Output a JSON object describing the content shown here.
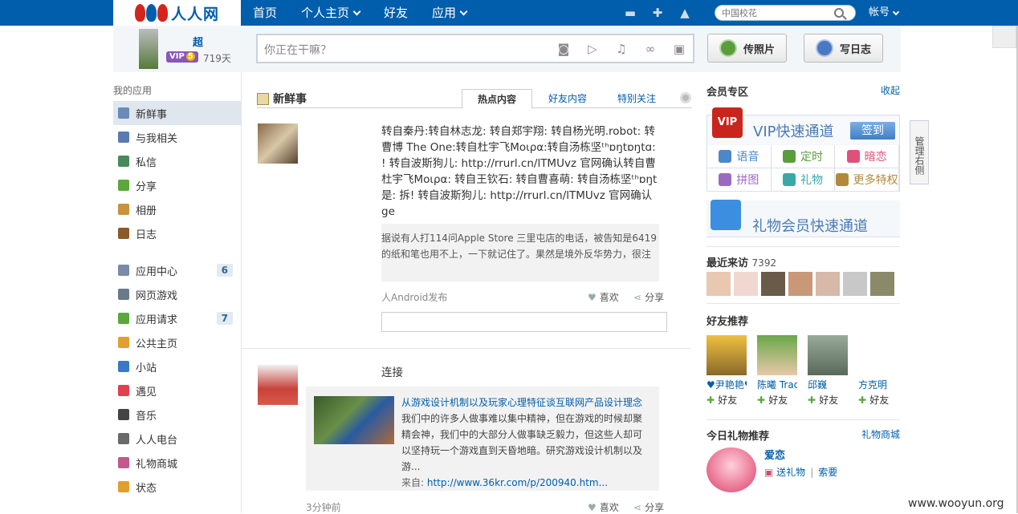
{
  "topbar": {
    "logo": "人人网",
    "nav": [
      "首页",
      "个人主页",
      "好友",
      "应用"
    ],
    "search_placeholder": "中国校花",
    "account": "帐号",
    "icons": [
      "chat-icon",
      "add-friend-icon",
      "bell-icon"
    ]
  },
  "publisher": {
    "name": "超",
    "vip": "VIP",
    "vip_level": "5",
    "days": "719天",
    "placeholder": "你正在干嘛？",
    "photo_btn": "传照片",
    "blog_btn": "写日志"
  },
  "sidebar": {
    "title": "我的应用",
    "items": [
      {
        "label": "新鲜事",
        "icon": "news-icon",
        "active": true
      },
      {
        "label": "与我相关",
        "icon": "mention-icon"
      },
      {
        "label": "私信",
        "icon": "message-icon"
      },
      {
        "label": "分享",
        "icon": "share-icon"
      },
      {
        "label": "相册",
        "icon": "album-icon"
      },
      {
        "label": "日志",
        "icon": "blog-icon"
      }
    ],
    "items2": [
      {
        "label": "应用中心",
        "icon": "app-center-icon",
        "badge": "6"
      },
      {
        "label": "网页游戏",
        "icon": "gamepad-icon"
      },
      {
        "label": "应用请求",
        "icon": "puzzle-icon",
        "badge": "7"
      },
      {
        "label": "公共主页",
        "icon": "bookmark-icon"
      },
      {
        "label": "小站",
        "icon": "station-icon"
      },
      {
        "label": "遇见",
        "icon": "heart-icon"
      },
      {
        "label": "音乐",
        "icon": "music-icon"
      },
      {
        "label": "人人电台",
        "icon": "radio-icon"
      },
      {
        "label": "礼物商城",
        "icon": "gift-icon"
      },
      {
        "label": "状态",
        "icon": "status-icon"
      }
    ]
  },
  "feed": {
    "title": "新鲜事",
    "tabs": [
      "热点内容",
      "好友内容",
      "特别关注"
    ],
    "post1": {
      "lines": [
        "转自秦丹:转自林志龙: 转自郑宇翔: 转自杨光明.robot: 转",
        "曹博 The One:转自杜宇飞Mοιρα:转自汤栋坚ᵗʰɒŋtɒŋtɑ:",
        "! 转自波斯狗儿: http://rrurl.cn/lTMUvz 官网确认转自曹",
        "杜宇飞Mοιρα: 转自王钦石: 转自曹喜萌: 转自汤栋坚ᵗʰɒŋt",
        "是: 拆! 转自波斯狗儿: http://rrurl.cn/lTMUvz 官网确认",
        "ge"
      ],
      "quote": [
        "据说有人打114问Apple Store 三里屯店的电话，被告知是6419",
        "的纸和笔也用不上，一下就记住了。果然是境外反华势力，很注"
      ],
      "source": "人Android发布",
      "like": "喜欢",
      "share": "分享"
    },
    "post2": {
      "title_tail": "连接",
      "article_title": "从游戏设计机制以及玩家心理特征谈互联网产品设计理念",
      "article_lines": [
        "我们中的许多人做事难以集中精神，但在游戏的时候却聚",
        "精会神，我们中的大部分人做事缺乏毅力，但这些人却可",
        "以坚持玩一个游戏直到天昏地暗。研究游戏设计机制以及",
        "游..."
      ],
      "source_label": "来自:",
      "source_url": "http://www.36kr.com/p/200940.htm...",
      "time": "3分钟前",
      "like": "喜欢",
      "share": "分享"
    }
  },
  "right": {
    "vip_title": "会员专区",
    "collapse": "收起",
    "vip_icon": "VIP",
    "vip_fast": "VIP快速通道",
    "sign_in": "签到",
    "vip_cells": [
      {
        "label": "语音",
        "color": "#4a88c8"
      },
      {
        "label": "定时",
        "color": "#5a9e3c"
      },
      {
        "label": "暗恋",
        "color": "#e0507a"
      },
      {
        "label": "拼图",
        "color": "#9a6ac0"
      },
      {
        "label": "礼物",
        "color": "#3aa8a8"
      },
      {
        "label": "更多特权",
        "color": "#b08a3a"
      }
    ],
    "gift_fast": "礼物会员快速通道",
    "recent_title": "最近来访",
    "recent_count": "7392",
    "friend_rec_title": "好友推荐",
    "friends": [
      {
        "name": "♥尹艳艳♥",
        "add": "好友"
      },
      {
        "name": "陈曦  Trac",
        "add": "好友"
      },
      {
        "name": "邱巍",
        "add": "好友"
      },
      {
        "name": "方克明",
        "add": "好友"
      }
    ],
    "gift_today": "今日礼物推荐",
    "gift_shop": "礼物商城",
    "gift_name": "爱恋",
    "send_gift": "送礼物",
    "ask_gift": "索要"
  },
  "side_tab": "管理右侧",
  "watermark": "www.wooyun.org"
}
